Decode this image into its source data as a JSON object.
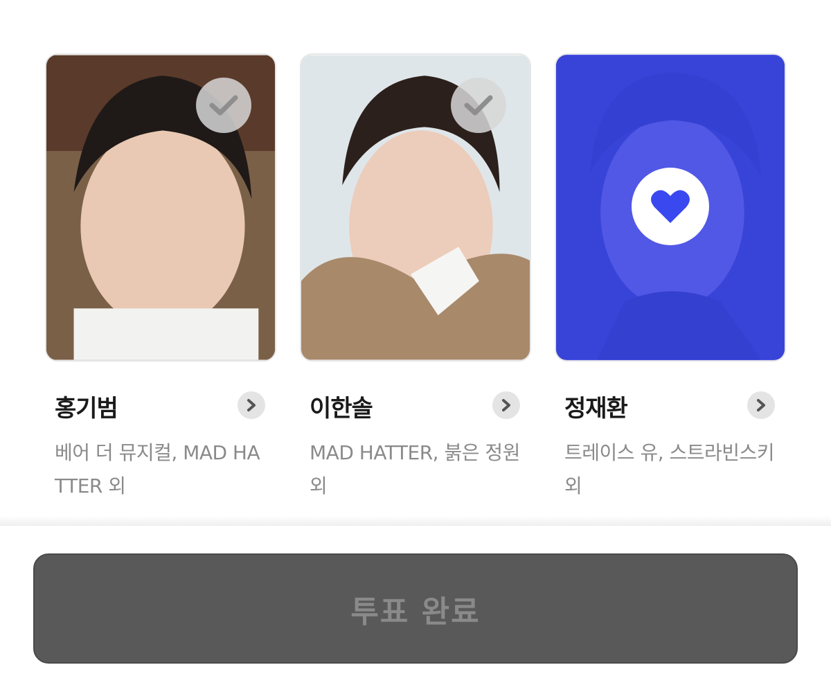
{
  "candidates": [
    {
      "name": "홍기범",
      "works": "베어 더 뮤지컬, MAD HATTER 외",
      "state": "unselected",
      "badge_icon": "check-icon"
    },
    {
      "name": "이한솔",
      "works": "MAD HATTER, 붉은 정원 외",
      "state": "unselected",
      "badge_icon": "check-icon"
    },
    {
      "name": "정재환",
      "works": "트레이스 유, 스트라빈스키 외",
      "state": "selected",
      "badge_icon": "heart-icon"
    }
  ],
  "submit": {
    "label": "투표 완료",
    "enabled": false
  },
  "colors": {
    "selected_overlay": "#3a48f0",
    "heart": "#3a48f0",
    "submit_bg": "#595959",
    "submit_text": "#8a8a8a"
  }
}
